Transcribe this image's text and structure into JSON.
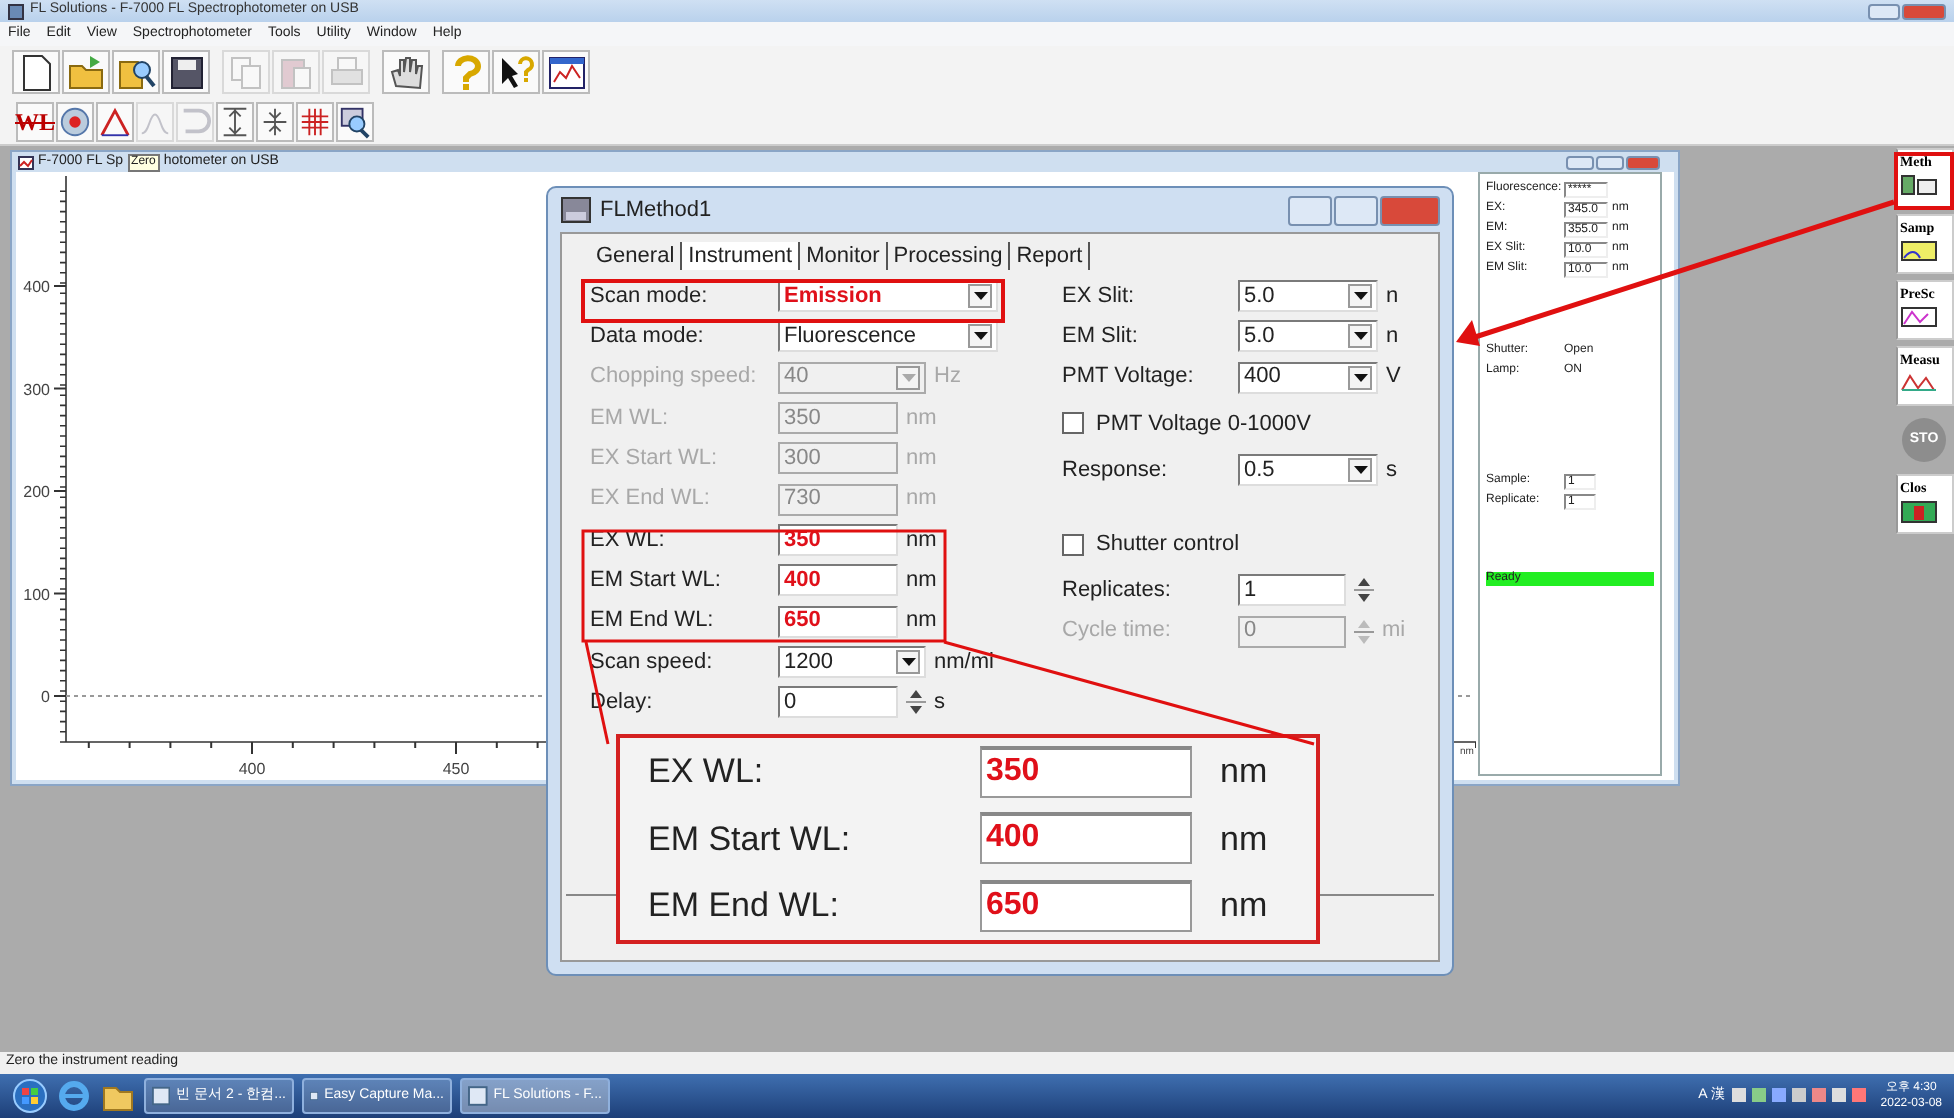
{
  "app": {
    "title": "FL Solutions - F-7000 FL Spectrophotometer on USB",
    "menu": [
      "File",
      "Edit",
      "View",
      "Spectrophotometer",
      "Tools",
      "Utility",
      "Window",
      "Help"
    ]
  },
  "toolbar_1": [
    {
      "disabled": false
    },
    {
      "disabled": false
    },
    {
      "disabled": false
    },
    {
      "disabled": false
    },
    {
      "disabled": true
    },
    {
      "disabled": true
    },
    {
      "disabled": true
    },
    {
      "disabled": false
    },
    {
      "disabled": false
    },
    {
      "disabled": false
    },
    {
      "disabled": false
    }
  ],
  "toolbar_2": {
    "label": "WL",
    "items": [
      {
        "disabled": false
      },
      {
        "disabled": false
      },
      {
        "disabled": true
      },
      {
        "disabled": true
      },
      {
        "disabled": false
      },
      {
        "disabled": false
      },
      {
        "disabled": false
      },
      {
        "disabled": false
      }
    ]
  },
  "spectrum_window": {
    "title_start": "F-7000 FL Sp",
    "title_end": "hotometer on USB",
    "tooltip": "Zero",
    "x_unit": "nm",
    "y_axis_labels": [
      "400",
      "300",
      "200",
      "100",
      "0"
    ],
    "x_axis_labels": [
      "400",
      "450"
    ]
  },
  "monitor_panel": {
    "readings": [
      {
        "label": "Fluorescence:",
        "value": "*****"
      },
      {
        "label": "EX:",
        "value": "345.0",
        "unit": "nm"
      },
      {
        "label": "EM:",
        "value": "355.0",
        "unit": "nm"
      },
      {
        "label": "EX Slit:",
        "value": "10.0",
        "unit": "nm"
      },
      {
        "label": "EM Slit:",
        "value": "10.0",
        "unit": "nm"
      }
    ],
    "states": [
      {
        "label": "Shutter:",
        "value": "Open"
      },
      {
        "label": "Lamp:",
        "value": "ON"
      }
    ],
    "counters": [
      {
        "label": "Sample:",
        "value": "1"
      },
      {
        "label": "Replicate:",
        "value": "1"
      }
    ],
    "status": "Ready"
  },
  "dialog": {
    "title": "FLMethod1",
    "tabs": [
      {
        "label": "General",
        "selected": false
      },
      {
        "label": "Instrument",
        "selected": true
      },
      {
        "label": "Monitor",
        "selected": false
      },
      {
        "label": "Processing",
        "selected": false
      },
      {
        "label": "Report",
        "selected": false
      }
    ],
    "left_fields": [
      {
        "kind": "combo",
        "label": "Scan mode:",
        "value": "Emission",
        "disabled": false,
        "highlight": true
      },
      {
        "kind": "combo",
        "label": "Data mode:",
        "value": "Fluorescence",
        "disabled": false,
        "highlight": false
      },
      {
        "kind": "combo-short",
        "label": "Chopping speed:",
        "value": "40",
        "unit": "Hz",
        "disabled": true,
        "highlight": false
      },
      {
        "kind": "text",
        "label": "EM WL:",
        "value": "350",
        "unit": "nm",
        "disabled": true,
        "highlight": false
      },
      {
        "kind": "text",
        "label": "EX Start WL:",
        "value": "300",
        "unit": "nm",
        "disabled": true,
        "highlight": false
      },
      {
        "kind": "text",
        "label": "EX End WL:",
        "value": "730",
        "unit": "nm",
        "disabled": true,
        "highlight": false
      },
      {
        "kind": "text",
        "label": "EX WL:",
        "value": "350",
        "unit": "nm",
        "disabled": false,
        "highlight": true
      },
      {
        "kind": "text",
        "label": "EM Start WL:",
        "value": "400",
        "unit": "nm",
        "disabled": false,
        "highlight": true
      },
      {
        "kind": "text",
        "label": "EM End WL:",
        "value": "650",
        "unit": "nm",
        "disabled": false,
        "highlight": true
      },
      {
        "kind": "combo-short",
        "label": "Scan speed:",
        "value": "1200",
        "unit": "nm/mi",
        "disabled": false,
        "highlight": false
      },
      {
        "kind": "spin",
        "label": "Delay:",
        "value": "0",
        "unit": "s",
        "disabled": false,
        "highlight": false
      }
    ],
    "right_fields": [
      {
        "kind": "combo",
        "label": "EX Slit:",
        "value": "5.0",
        "unit": "n",
        "disabled": false
      },
      {
        "kind": "combo",
        "label": "EM Slit:",
        "value": "5.0",
        "unit": "n",
        "disabled": false
      },
      {
        "kind": "combo",
        "label": "PMT Voltage:",
        "value": "400",
        "unit": "V",
        "disabled": false
      },
      {
        "kind": "checkbox",
        "label": "PMT Voltage 0-1000V",
        "checked": false,
        "disabled": false
      },
      {
        "kind": "combo",
        "label": "Response:",
        "value": "0.5",
        "unit": "s",
        "disabled": false
      },
      {
        "kind": "checkbox",
        "label": "Shutter control",
        "checked": false,
        "disabled": false
      },
      {
        "kind": "spin",
        "label": "Replicates:",
        "value": "1",
        "disabled": false
      },
      {
        "kind": "spin",
        "label": "Cycle time:",
        "value": "0",
        "unit": "mi",
        "disabled": true
      }
    ]
  },
  "magnified": [
    {
      "label": "EX WL:",
      "value": "350",
      "unit": "nm"
    },
    {
      "label": "EM Start WL:",
      "value": "400",
      "unit": "nm"
    },
    {
      "label": "EM End WL:",
      "value": "650",
      "unit": "nm"
    }
  ],
  "side_toolbar": [
    {
      "label": "Meth",
      "disabled": false
    },
    {
      "label": "Samp",
      "disabled": false
    },
    {
      "label": "PreSc",
      "disabled": false
    },
    {
      "label": "Measu",
      "disabled": false
    },
    {
      "label": "STO",
      "disabled": true
    },
    {
      "label": "Clos",
      "disabled": false
    }
  ],
  "status_bar": "Zero the instrument reading",
  "taskbar": {
    "tasks": [
      {
        "label": "빈 문서 2 - 한컴...",
        "selected": false
      },
      {
        "label": "Easy Capture Ma...",
        "selected": false
      },
      {
        "label": "FL Solutions - F...",
        "selected": true
      }
    ],
    "ime": "A 漢",
    "time": "오후 4:30",
    "date": "2022-03-08"
  }
}
